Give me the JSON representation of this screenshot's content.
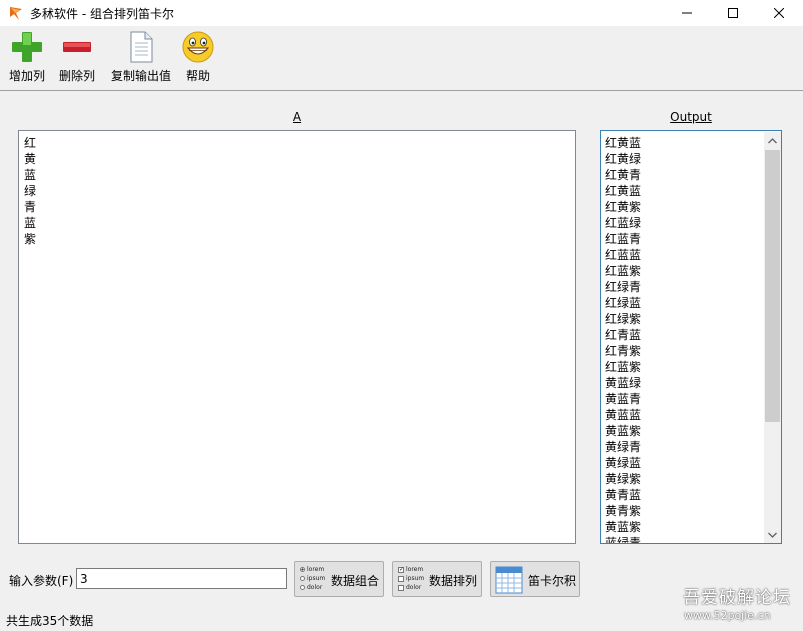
{
  "window": {
    "title": "多秫软件 - 组合排列笛卡尔"
  },
  "toolbar": {
    "items": [
      {
        "label": "增加列",
        "icon": "plus-icon"
      },
      {
        "label": "删除列",
        "icon": "minus-icon"
      },
      {
        "label": "复制输出值",
        "icon": "document-icon"
      },
      {
        "label": "帮助",
        "icon": "smiley-icon"
      }
    ]
  },
  "column_a": {
    "header": "A",
    "values": [
      "红",
      "黄",
      "蓝",
      "绿",
      "青",
      "蓝",
      "紫"
    ]
  },
  "output": {
    "header": "Output",
    "values": [
      "红黄蓝",
      "红黄绿",
      "红黄青",
      "红黄蓝",
      "红黄紫",
      "红蓝绿",
      "红蓝青",
      "红蓝蓝",
      "红蓝紫",
      "红绿青",
      "红绿蓝",
      "红绿紫",
      "红青蓝",
      "红青紫",
      "红蓝紫",
      "黄蓝绿",
      "黄蓝青",
      "黄蓝蓝",
      "黄蓝紫",
      "黄绿青",
      "黄绿蓝",
      "黄绿紫",
      "黄青蓝",
      "黄青紫",
      "黄蓝紫",
      "蓝绿青"
    ]
  },
  "params": {
    "label": "输入参数(F)",
    "value": "3"
  },
  "buttons": {
    "combine": {
      "label": "数据组合",
      "mini": [
        "lorem",
        "ipsum",
        "dolor"
      ]
    },
    "permute": {
      "label": "数据排列",
      "mini": [
        "lorem",
        "ipsum",
        "dolor"
      ]
    },
    "cartesian": {
      "label": "笛卡尔积"
    }
  },
  "status": {
    "text": "共生成35个数据"
  },
  "watermark": {
    "text1": "吾爱破解论坛",
    "text2": "www.52pojie.cn"
  }
}
